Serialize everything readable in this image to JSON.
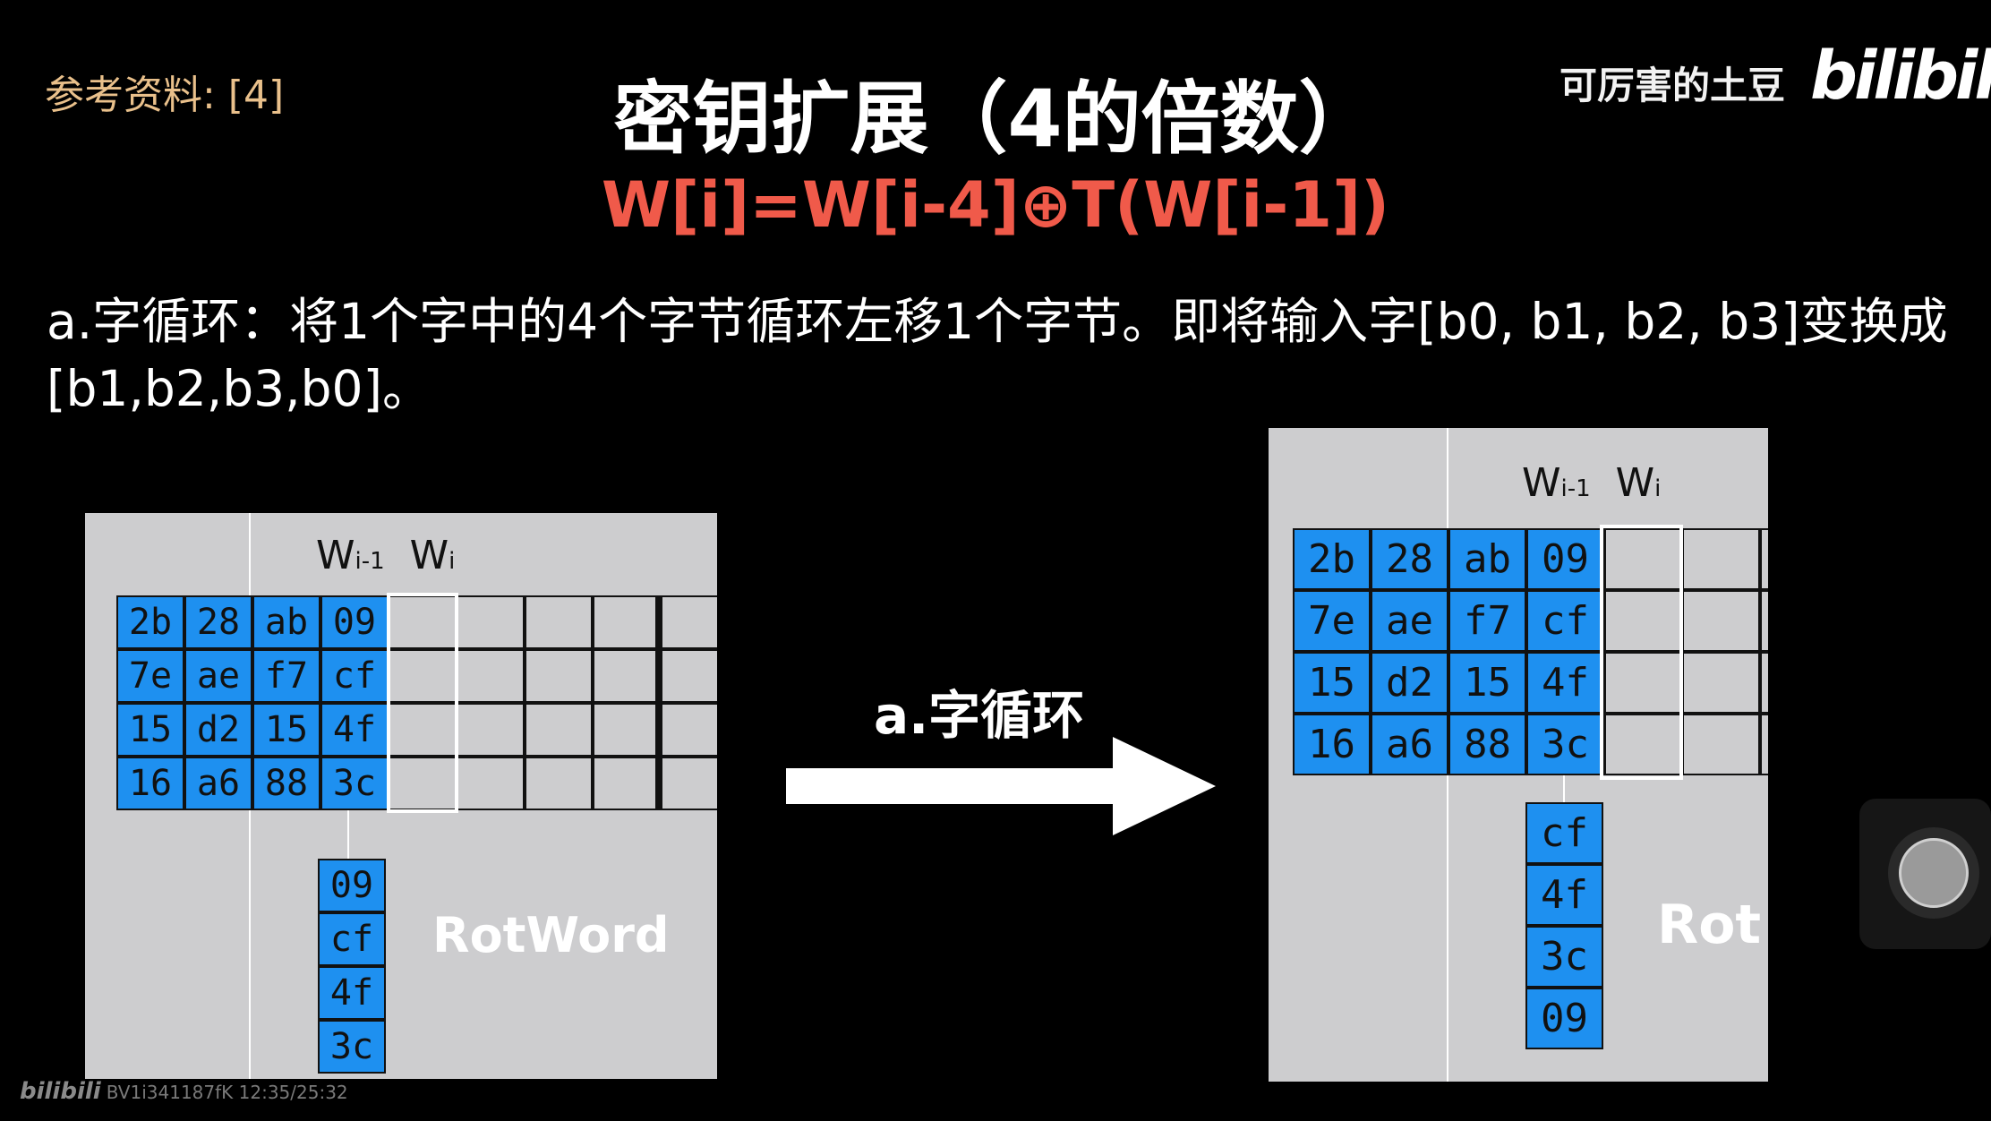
{
  "reference": "参考资料: [4]",
  "title": "密钥扩展（4的倍数）",
  "formula": "W[i]=W[i-4]⊕T(W[i-1])",
  "uploader": "可厉害的土豆",
  "logo": "bilibili",
  "description": "a.字循环：将1个字中的4个字节循环左移1个字节。即将输入字[b0, b1, b2, b3]变换成[b1,b2,b3,b0]。",
  "header": {
    "wprev": "W",
    "wprev_sub": "i-1",
    "wcur": "W",
    "wcur_sub": "i"
  },
  "arrow_label": "a.字循环",
  "rotword_label": "RotWord",
  "rotword_label_cut": "Rot",
  "matrix": [
    [
      "2b",
      "28",
      "ab",
      "09"
    ],
    [
      "7e",
      "ae",
      "f7",
      "cf"
    ],
    [
      "15",
      "d2",
      "15",
      "4f"
    ],
    [
      "16",
      "a6",
      "88",
      "3c"
    ]
  ],
  "column_before": [
    "09",
    "cf",
    "4f",
    "3c"
  ],
  "column_after": [
    "cf",
    "4f",
    "3c",
    "09"
  ],
  "footer": {
    "logo": "bilibili",
    "info": "BV1i341187fK 12:35/25:32"
  },
  "colors": {
    "cell_blue": "#1e90f0",
    "formula_red": "#f05a4a",
    "reference_gold": "#e9c08b",
    "panel_gray": "#cdcdcf"
  }
}
